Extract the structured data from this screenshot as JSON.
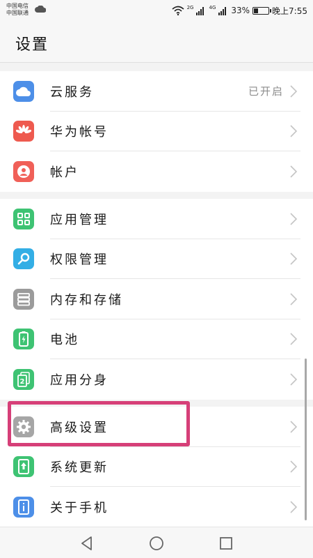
{
  "status": {
    "carrier_1": "中国电信",
    "carrier_2": "中国联通",
    "signal_1_tag": "2G",
    "signal_2_tag": "4G",
    "battery_percent": "33%",
    "battery_level": 0.33,
    "time": "晚上7:55"
  },
  "header": {
    "title": "设置"
  },
  "groups": [
    {
      "items": [
        {
          "label": "云服务",
          "value": "已开启",
          "icon": "cloud-icon",
          "color": "#4d8fe8"
        },
        {
          "label": "华为帐号",
          "icon": "huawei-logo-icon",
          "color": "#ee5a4f"
        },
        {
          "label": "帐户",
          "icon": "user-icon",
          "color": "#f06058"
        }
      ]
    },
    {
      "items": [
        {
          "label": "应用管理",
          "icon": "apps-grid-icon",
          "color": "#3ec373"
        },
        {
          "label": "权限管理",
          "icon": "key-icon",
          "color": "#33aee5"
        },
        {
          "label": "内存和存储",
          "icon": "storage-icon",
          "color": "#9b9b9b"
        },
        {
          "label": "电池",
          "icon": "battery-icon",
          "color": "#3ec373"
        },
        {
          "label": "应用分身",
          "icon": "app-twin-icon",
          "color": "#3ec373"
        }
      ]
    },
    {
      "items": [
        {
          "label": "高级设置",
          "icon": "gear-icon",
          "color": "#a6a6a6"
        },
        {
          "label": "系统更新",
          "icon": "update-icon",
          "color": "#3ec373"
        },
        {
          "label": "关于手机",
          "icon": "info-icon",
          "color": "#4d8fe8"
        }
      ]
    }
  ],
  "highlight": {
    "color": "#d63f78",
    "target": "高级设置"
  },
  "nav": {
    "back": "back-icon",
    "home": "home-icon",
    "recents": "recents-icon"
  }
}
